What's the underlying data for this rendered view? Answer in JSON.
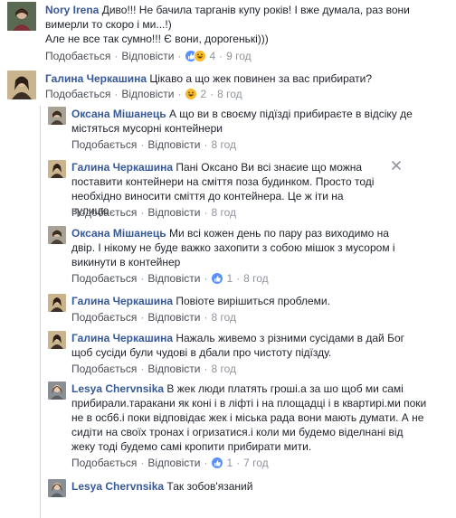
{
  "labels": {
    "like": "Подобається",
    "reply": "Відповісти",
    "dot": "·"
  },
  "colors": {
    "name": "#365899",
    "link": "#4b4f56",
    "meta": "#90949c",
    "like_blue": "#5890ff",
    "haha_yellow": "#f7b928"
  },
  "comments": [
    {
      "author": "Nory Irena",
      "text": "Диво!!! Не бачила тарганів купу років! І вже думала, раз вони вимерли то скоро і ми...!)",
      "text2": "Але не все так сумно!!! Є вони, дорогенькі)))",
      "reactions": [
        "like-icon",
        "haha-icon"
      ],
      "reaction_count": "4",
      "time": "9 год"
    },
    {
      "author": "Галина Черкашина",
      "text": "Цікаво а що жек повинен за вас прибирати?",
      "reactions": [
        "haha-icon"
      ],
      "reaction_count": "2",
      "time": "8 год"
    },
    {
      "author": "Оксана Мішанець",
      "text": "А що ви в своєму підїзді прибираєте в відсіку де містяться мусорні контейнери",
      "time": "8 год"
    },
    {
      "author": "Галина Черкашина",
      "text": "Пані Оксано Ви всі знаєие що можна поставити контейнери на сміття поза будинком. Просто тоді необхідно виносити сміття до контейнера. Це ж іти на вулицю",
      "time": "8 год"
    },
    {
      "author": "Оксана Мішанець",
      "text": "Ми всі кожен день по пару раз виходимо на двір. І нікому не буде важко захопити з собою мішок з мусором і викинути в контейнер",
      "reactions": [
        "like-icon"
      ],
      "reaction_count": "1",
      "time": "8 год"
    },
    {
      "author": "Галина Черкашина",
      "text": "Повіоте вирішиться проблеми.",
      "time": "8 год"
    },
    {
      "author": "Галина Черкашина",
      "text": "Нажаль живемо з різними сусідами в дай Бог щоб сусіди були чудові в дбали про чистоту підїзду.",
      "time": "8 год"
    },
    {
      "author": "Lesya Chervnsika",
      "text": "В жек люди платять гроші.а за шо щоб ми самі прибирали.таракани як коні і в ліфті і на площадці і в квартирі.ми поки не в осб6.і поки відповідає жек і міська рада вони мають думати. А не сидіти на своїх тронах і огризатися.і коли ми будемо віделнані від жеку тоді будемо самі кропити прибирати мити.",
      "reactions": [
        "like-icon"
      ],
      "reaction_count": "1",
      "time": "7 год"
    },
    {
      "author": "Lesya Chervnsika",
      "text": "Так зобов'язаний"
    }
  ]
}
